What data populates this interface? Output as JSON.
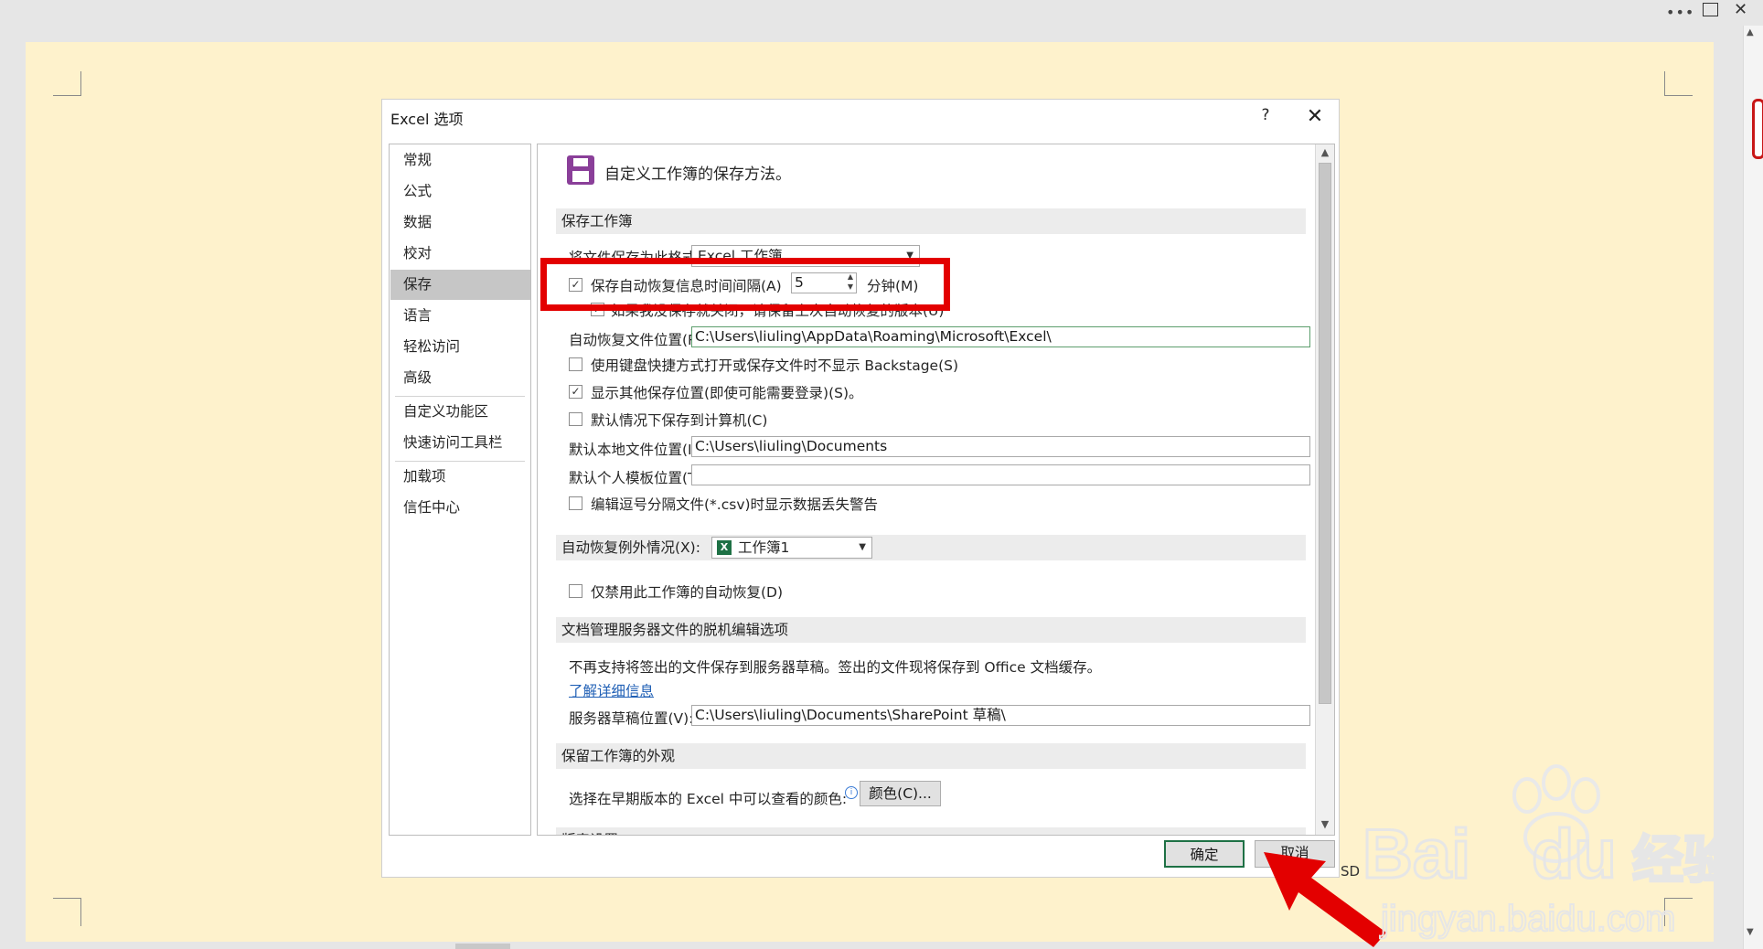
{
  "window": {
    "more_icon": "ellipsis-icon",
    "restore_icon": "window-icon",
    "close_icon": "close-icon"
  },
  "dialog": {
    "title": "Excel 选项",
    "help": "?",
    "close": "✕"
  },
  "sidebar": {
    "items": [
      "常规",
      "公式",
      "数据",
      "校对",
      "保存",
      "语言",
      "轻松访问",
      "高级",
      "自定义功能区",
      "快速访问工具栏",
      "加载项",
      "信任中心"
    ],
    "selected": "保存"
  },
  "content": {
    "heading": "自定义工作簿的保存方法。",
    "save_section": {
      "title": "保存工作簿",
      "format_label": "将文件保存为此格式(F):",
      "format_value": "Excel 工作簿",
      "autorecover_label": "保存自动恢复信息时间间隔(A)",
      "autorecover_checked": true,
      "autorecover_minutes": "5",
      "minutes_label": "分钟(M)",
      "keep_last_label": "如果我没保存就关闭，请保留上次自动恢复的版本(U)",
      "keep_last_checked": true,
      "autorecover_location_label": "自动恢复文件位置(R):",
      "autorecover_location_value": "C:\\Users\\liuling\\AppData\\Roaming\\Microsoft\\Excel\\",
      "no_backstage_label": "使用键盘快捷方式打开或保存文件时不显示 Backstage(S)",
      "no_backstage_checked": false,
      "show_other_label": "显示其他保存位置(即使可能需要登录)(S)。",
      "show_other_checked": true,
      "save_to_computer_label": "默认情况下保存到计算机(C)",
      "save_to_computer_checked": false,
      "default_local_label": "默认本地文件位置(I):",
      "default_local_value": "C:\\Users\\liuling\\Documents",
      "template_label": "默认个人模板位置(T):",
      "template_value": "",
      "csv_warning_label": "编辑逗号分隔文件(*.csv)时显示数据丢失警告",
      "csv_warning_checked": false
    },
    "exceptions_section": {
      "title": "自动恢复例外情况(X):",
      "workbook": "工作簿1",
      "disable_label": "仅禁用此工作簿的自动恢复(D)",
      "disable_checked": false
    },
    "offline_section": {
      "title": "文档管理服务器文件的脱机编辑选项",
      "note": "不再支持将签出的文件保存到服务器草稿。签出的文件现将保存到 Office 文档缓存。",
      "learn_more": "了解详细信息",
      "drafts_label": "服务器草稿位置(V):",
      "drafts_value": "C:\\Users\\liuling\\Documents\\SharePoint 草稿\\"
    },
    "appearance_section": {
      "title": "保留工作簿的外观",
      "colors_label": "选择在早期版本的 Excel 中可以查看的颜色:",
      "colors_button": "颜色(C)...",
      "next_section_partial": "版表设置"
    }
  },
  "footer": {
    "ok": "确定",
    "cancel": "取消"
  },
  "document_text": "SD",
  "watermark": {
    "brand": "Bai du 经验",
    "url": "jingyan.baidu.com"
  },
  "colors": {
    "highlight": "#e30000",
    "accent_green": "#1e7145",
    "page": "#fef2cc"
  }
}
